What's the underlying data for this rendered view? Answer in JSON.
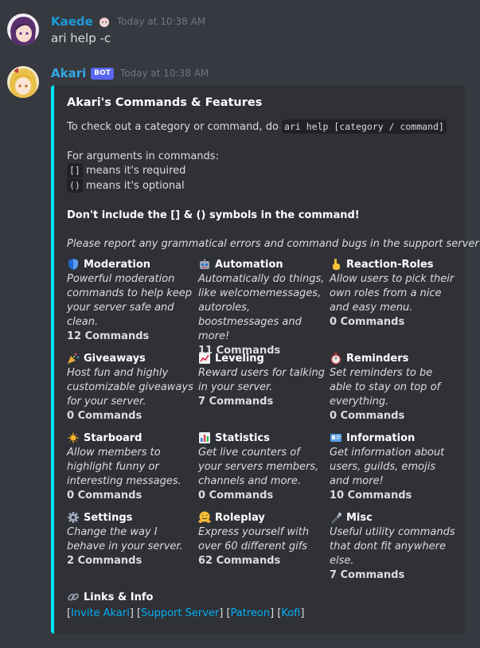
{
  "messages": [
    {
      "author": "Kaede",
      "timestamp": "Today at 10:38 AM",
      "text": "ari help -c"
    },
    {
      "author": "Akari",
      "badge": "BOT",
      "timestamp": "Today at 10:38 AM"
    }
  ],
  "embed": {
    "accent_color": "#00e5ff",
    "title": "Akari's Commands & Features",
    "intro_prefix": "To check out a category or command, do ",
    "intro_code": "ari help [category / command]",
    "args_heading": "For arguments in commands:",
    "required_code": "[]",
    "required_text": " means it's required",
    "optional_code": "()",
    "optional_text": " means it's optional",
    "warning": "Don't include the [] & () symbols in the command!",
    "report": "Please report any grammatical errors and command bugs in the support server!",
    "fields": [
      {
        "icon": "shield-icon",
        "name": "Moderation",
        "desc": "Powerful moderation commands to help keep your server safe and clean.",
        "count": "12 Commands"
      },
      {
        "icon": "robot-icon",
        "name": "Automation",
        "desc": "Automatically do things, like welcomemessages, autoroles, boostmessages and more!",
        "count": "11 Commands"
      },
      {
        "icon": "pointing-hand-icon",
        "name": "Reaction-Roles",
        "desc": "Allow users to pick their own roles from a nice and easy menu.",
        "count": "0 Commands"
      },
      {
        "icon": "party-popper-icon",
        "name": "Giveaways",
        "desc": "Host fun and highly customizable giveaways for your server.",
        "count": "0 Commands"
      },
      {
        "icon": "chart-up-icon",
        "name": "Leveling",
        "desc": "Reward users for talking in your server.",
        "count": "7 Commands"
      },
      {
        "icon": "stopwatch-icon",
        "name": "Reminders",
        "desc": "Set reminders to be able to stay on top of everything.",
        "count": "0 Commands"
      },
      {
        "icon": "star-icon",
        "name": "Starboard",
        "desc": "Allow members to highlight funny or interesting messages.",
        "count": "0 Commands"
      },
      {
        "icon": "bar-chart-icon",
        "name": "Statistics",
        "desc": "Get live counters of your servers members, channels and more.",
        "count": "0 Commands"
      },
      {
        "icon": "id-card-icon",
        "name": "Information",
        "desc": "Get information about users, guilds, emojis and more!",
        "count": "10 Commands"
      },
      {
        "icon": "gear-icon",
        "name": "Settings",
        "desc": "Change the way I behave in your server.",
        "count": "2 Commands"
      },
      {
        "icon": "hugging-face-icon",
        "name": "Roleplay",
        "desc": "Express yourself with over 60 different gifs",
        "count": "62 Commands"
      },
      {
        "icon": "flashlight-icon",
        "name": "Misc",
        "desc": "Useful utility commands that dont fit anywhere else.",
        "count": "7 Commands"
      }
    ],
    "links_title": "Links & Info",
    "links": [
      "Invite Akari",
      "Support Server",
      "Patreon",
      "Kofi"
    ]
  }
}
